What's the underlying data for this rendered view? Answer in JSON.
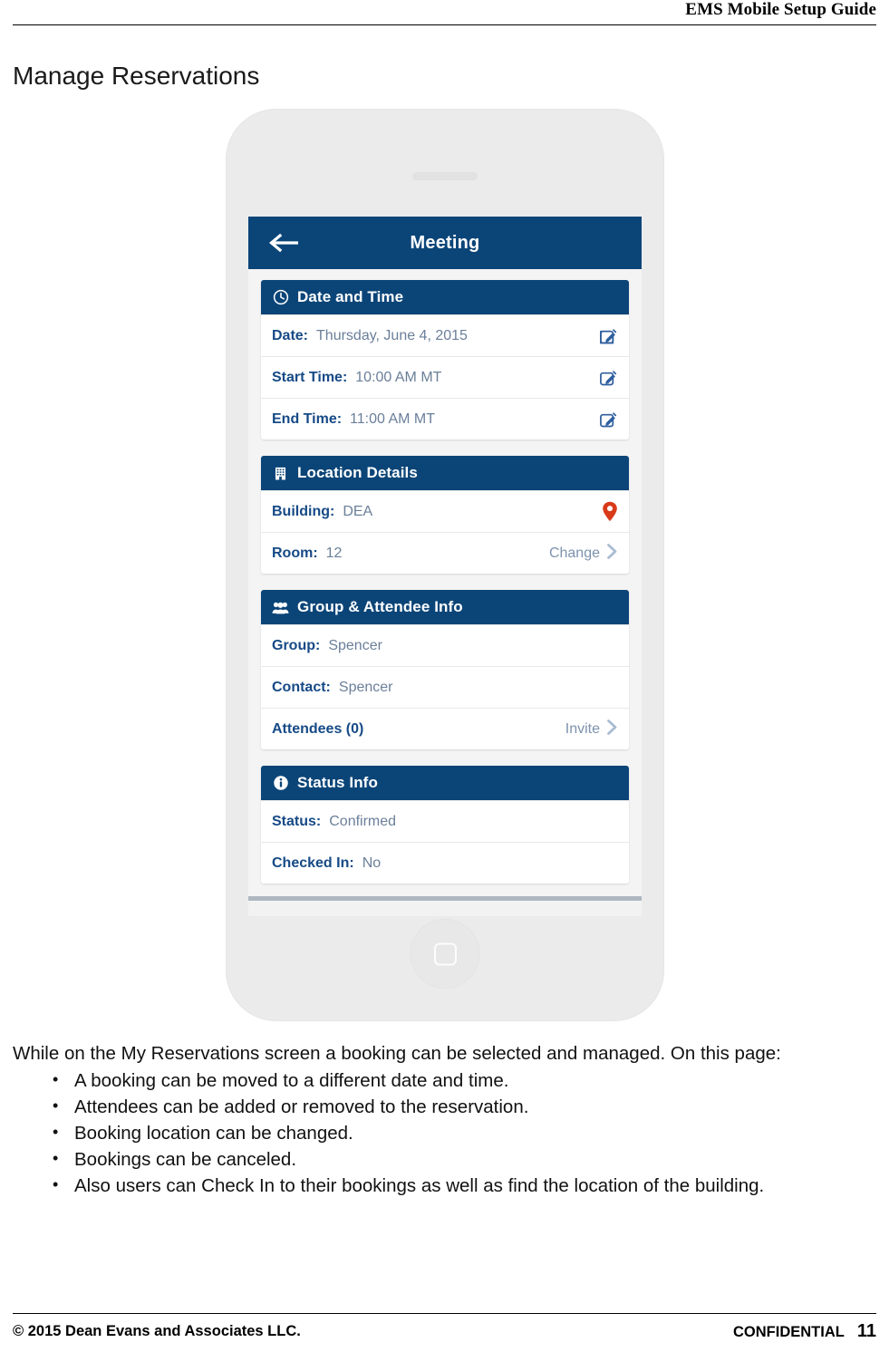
{
  "document": {
    "header_title": "EMS Mobile Setup Guide",
    "page_title": "Manage Reservations",
    "intro": "While on the My Reservations screen a booking can be selected and managed. On this page:",
    "bullets": [
      "A booking can be moved to a different date and time.",
      "Attendees can be added or removed to the reservation.",
      "Booking location can be changed.",
      "Bookings can be canceled.",
      "Also users can Check In to their bookings as well as find the location of the building."
    ],
    "footer": {
      "copyright": "© 2015 Dean Evans and Associates LLC.",
      "classification": "CONFIDENTIAL",
      "page_number": "11"
    }
  },
  "colors": {
    "header_blue": "#0b4578",
    "label_blue": "#164a86",
    "value_gray": "#6a7f99",
    "pin_red": "#d93a1a",
    "screen_bg": "#f4f4f4"
  },
  "screenshot": {
    "navbar": {
      "back_icon": "arrow-left-icon",
      "title": "Meeting"
    },
    "sections": [
      {
        "icon": "clock-icon",
        "title": "Date and Time",
        "rows": [
          {
            "label": "Date:",
            "value": "Thursday, June 4, 2015",
            "action_icon": "edit-icon"
          },
          {
            "label": "Start Time:",
            "value": "10:00 AM MT",
            "action_icon": "edit-icon"
          },
          {
            "label": "End Time:",
            "value": "11:00 AM MT",
            "action_icon": "edit-icon"
          }
        ]
      },
      {
        "icon": "building-icon",
        "title": "Location Details",
        "rows": [
          {
            "label": "Building:",
            "value": "DEA",
            "action_icon": "map-pin-icon"
          },
          {
            "label": "Room:",
            "value": "12",
            "action_text": "Change",
            "action_icon": "chevron-right-icon"
          }
        ]
      },
      {
        "icon": "group-icon",
        "title": "Group & Attendee Info",
        "rows": [
          {
            "label": "Group:",
            "value": "Spencer"
          },
          {
            "label": "Contact:",
            "value": "Spencer"
          },
          {
            "label": "Attendees (0)",
            "value": "",
            "action_text": "Invite",
            "action_icon": "chevron-right-icon"
          }
        ]
      },
      {
        "icon": "info-icon",
        "title": "Status Info",
        "rows": [
          {
            "label": "Status:",
            "value": "Confirmed"
          },
          {
            "label": "Checked In:",
            "value": "No"
          }
        ]
      }
    ],
    "device": {
      "speaker": "earpiece-speaker",
      "home_button": "home-button"
    }
  }
}
